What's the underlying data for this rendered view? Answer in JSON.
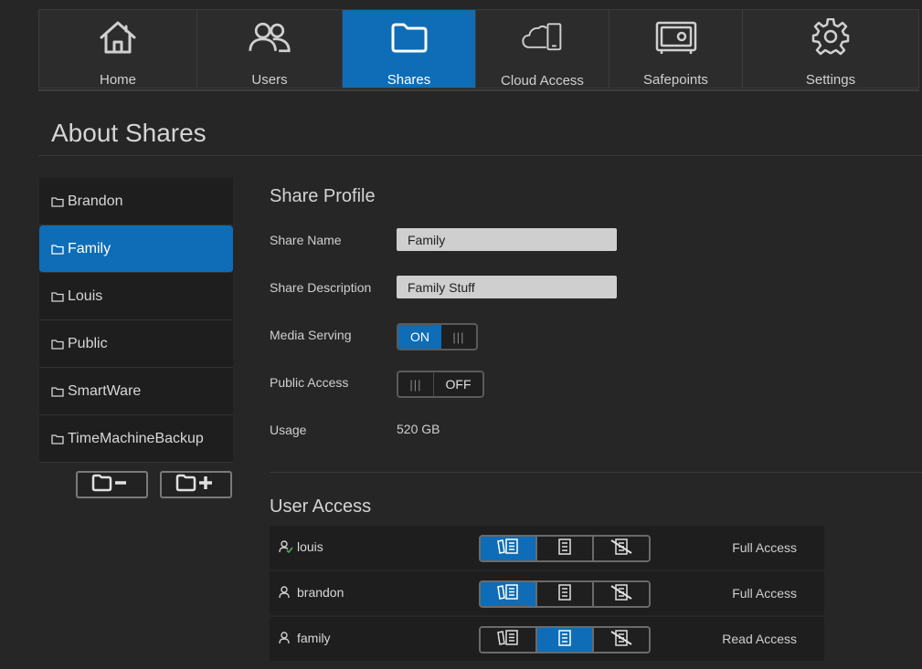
{
  "nav": {
    "items": [
      {
        "label": "Home",
        "icon": "home-icon"
      },
      {
        "label": "Users",
        "icon": "users-icon"
      },
      {
        "label": "Shares",
        "icon": "folder-icon"
      },
      {
        "label": "Cloud Access",
        "icon": "cloud-device-icon"
      },
      {
        "label": "Safepoints",
        "icon": "safe-icon"
      },
      {
        "label": "Settings",
        "icon": "gear-icon"
      }
    ],
    "active": "Shares"
  },
  "page": {
    "title": "About Shares"
  },
  "shares": {
    "items": [
      "Brandon",
      "Family",
      "Louis",
      "Public",
      "SmartWare",
      "TimeMachineBackup"
    ],
    "selected": "Family",
    "remove_icon": "folder-minus-icon",
    "add_icon": "folder-plus-icon"
  },
  "profile": {
    "title": "Share Profile",
    "share_name_label": "Share Name",
    "share_name_value": "Family",
    "description_label": "Share Description",
    "description_value": "Family Stuff",
    "media_label": "Media Serving",
    "media_on_label": "ON",
    "public_label": "Public Access",
    "public_off_label": "OFF",
    "usage_label": "Usage",
    "usage_value": "520 GB"
  },
  "access": {
    "title": "User Access",
    "users": [
      {
        "name": "louis",
        "status": "Full Access",
        "selected": 0,
        "icon": "person-check-icon"
      },
      {
        "name": "brandon",
        "status": "Full Access",
        "selected": 0,
        "icon": "person-icon"
      },
      {
        "name": "family",
        "status": "Read Access",
        "selected": 1,
        "icon": "person-icon"
      }
    ],
    "option_icons": [
      "full-access-icon",
      "read-only-icon",
      "no-access-icon"
    ]
  },
  "colors": {
    "accent": "#0e6db6",
    "background": "#262626",
    "panel": "#1e1e1e"
  }
}
